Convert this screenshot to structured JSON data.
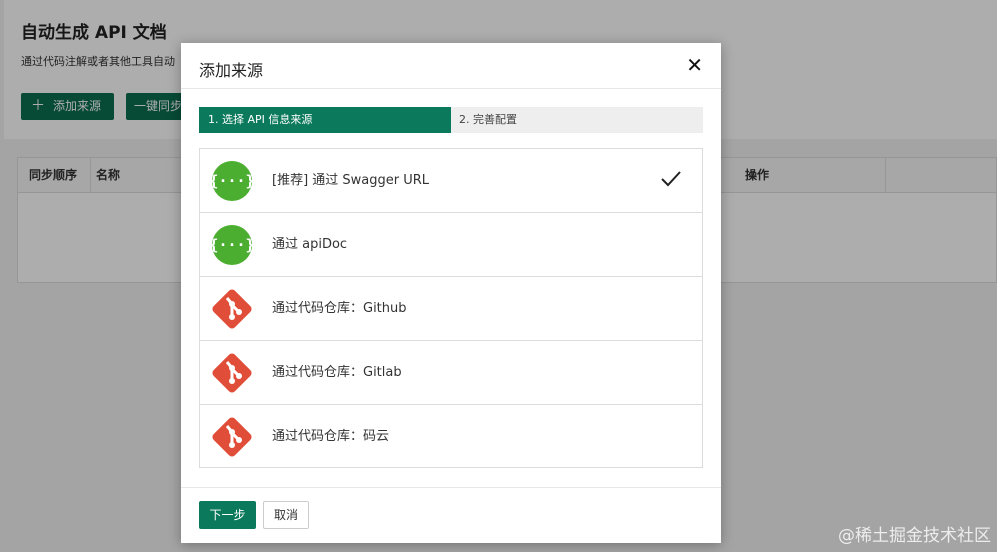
{
  "page": {
    "title": "自动生成 API 文档",
    "description": "通过代码注解或者其他工具自动",
    "add_button": "添加来源",
    "sync_button": "一键同步",
    "table_headers": [
      "同步顺序",
      "名称",
      "操作"
    ]
  },
  "modal": {
    "title": "添加来源",
    "close": "✕",
    "steps": [
      "1. 选择 API 信息来源",
      "2. 完善配置"
    ],
    "options": [
      {
        "label": "[推荐] 通过 Swagger URL",
        "icon": "swagger-icon",
        "selected": true
      },
      {
        "label": "通过 apiDoc",
        "icon": "swagger-icon",
        "selected": false
      },
      {
        "label": "通过代码仓库：Github",
        "icon": "git-icon",
        "selected": false
      },
      {
        "label": "通过代码仓库：Gitlab",
        "icon": "git-icon",
        "selected": false
      },
      {
        "label": "通过代码仓库：码云",
        "icon": "git-icon",
        "selected": false
      }
    ],
    "next_button": "下一步",
    "cancel_button": "取消"
  },
  "watermark": "@稀土掘金技术社区",
  "colors": {
    "primary": "#0b7a5c",
    "swagger": "#4bae31",
    "git": "#e04e39"
  }
}
